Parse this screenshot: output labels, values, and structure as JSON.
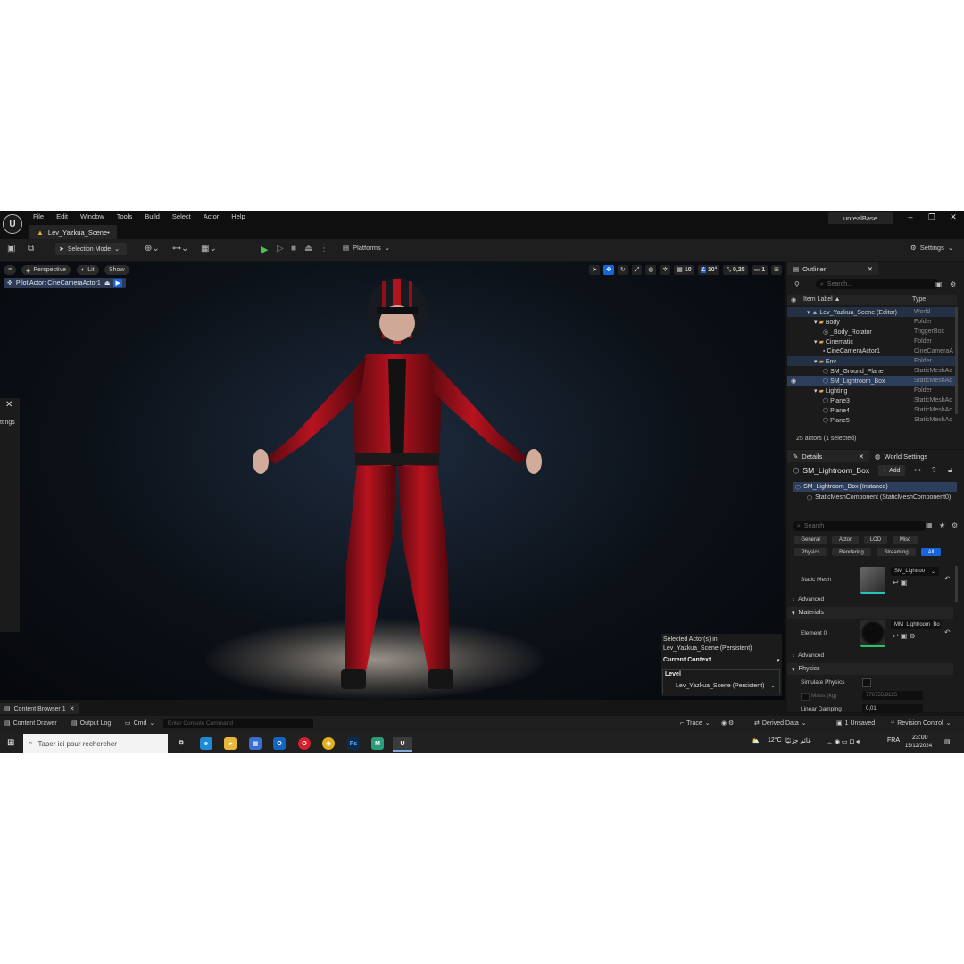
{
  "window": {
    "title": "unrealBase",
    "level_tab": "Lev_Yazkua_Scene•"
  },
  "menu": [
    "File",
    "Edit",
    "Window",
    "Tools",
    "Build",
    "Select",
    "Actor",
    "Help"
  ],
  "toolbar": {
    "selection_mode": "Selection Mode",
    "platforms": "Platforms",
    "settings": "Settings"
  },
  "viewport": {
    "perspective": "Perspective",
    "lit": "Lit",
    "show": "Show",
    "pilot": "Pilot Actor: CineCameraActor1",
    "grid_value": "10",
    "rotation_value": "10°",
    "scale_value": "0,25",
    "camera_speed": "1",
    "left_panel_text": "ttings",
    "context": {
      "selected_line1": "Selected Actor(s) in",
      "selected_line2": "Lev_Yazkua_Scene (Persistent)",
      "current_context": "Current Context",
      "level_label": "Level",
      "level_value": "Lev_Yazkua_Scene (Persistent)"
    }
  },
  "outliner": {
    "tab": "Outliner",
    "search_placeholder": "Search...",
    "col_label": "Item Label ▲",
    "col_type": "Type",
    "rows": [
      {
        "label": "Lev_Yazkua_Scene (Editor)",
        "type": "World"
      },
      {
        "label": "Body",
        "type": "Folder"
      },
      {
        "label": "_Body_Rotator",
        "type": "TriggerBox"
      },
      {
        "label": "Cinematic",
        "type": "Folder"
      },
      {
        "label": "CineCameraActor1",
        "type": "CineCameraA"
      },
      {
        "label": "Env",
        "type": "Folder"
      },
      {
        "label": "SM_Ground_Plane",
        "type": "StaticMeshAc"
      },
      {
        "label": "SM_Lightroom_Box",
        "type": "StaticMeshAc"
      },
      {
        "label": "Lighting",
        "type": "Folder"
      },
      {
        "label": "Plane3",
        "type": "StaticMeshAc"
      },
      {
        "label": "Plane4",
        "type": "StaticMeshAc"
      },
      {
        "label": "Plane5",
        "type": "StaticMeshAc"
      }
    ],
    "count": "25 actors (1 selected)"
  },
  "details": {
    "tab": "Details",
    "world_tab": "World Settings",
    "object_name": "SM_Lightroom_Box",
    "add": "Add",
    "instance": "SM_Lightroom_Box (Instance)",
    "component": "StaticMeshComponent (StaticMeshComponent0)",
    "search_placeholder": "Search",
    "filters_row1": [
      "General",
      "Actor",
      "LOD",
      "Misc"
    ],
    "filters_row2": [
      "Physics",
      "Rendering",
      "Streaming",
      "All"
    ],
    "static_mesh_label": "Static Mesh",
    "static_mesh_value": "SM_Lightroo",
    "advanced1": "Advanced",
    "materials": "Materials",
    "element0_label": "Element 0",
    "element0_value": "MM_Lightroom_Bo",
    "advanced2": "Advanced",
    "physics": "Physics",
    "simulate_physics": "Simulate Physics",
    "mass": "Mass (kg)",
    "mass_value": "776755,8125",
    "linear_damping": "Linear Damping",
    "linear_damping_value": "0,01"
  },
  "bottom": {
    "content_browser": "Content Browser 1",
    "content_drawer": "Content Drawer",
    "output_log": "Output Log",
    "cmd": "Cmd",
    "console_placeholder": "Enter Console Command",
    "trace": "Trace",
    "derived_data": "Derived Data",
    "unsaved": "1 Unsaved",
    "revision_control": "Revision Control"
  },
  "taskbar": {
    "search_placeholder": "Taper ici pour rechercher",
    "weather": "12°C",
    "weather_text": "غائم جزئيًا",
    "lang": "FRA",
    "time": "23:00",
    "date": "15/12/2024"
  }
}
